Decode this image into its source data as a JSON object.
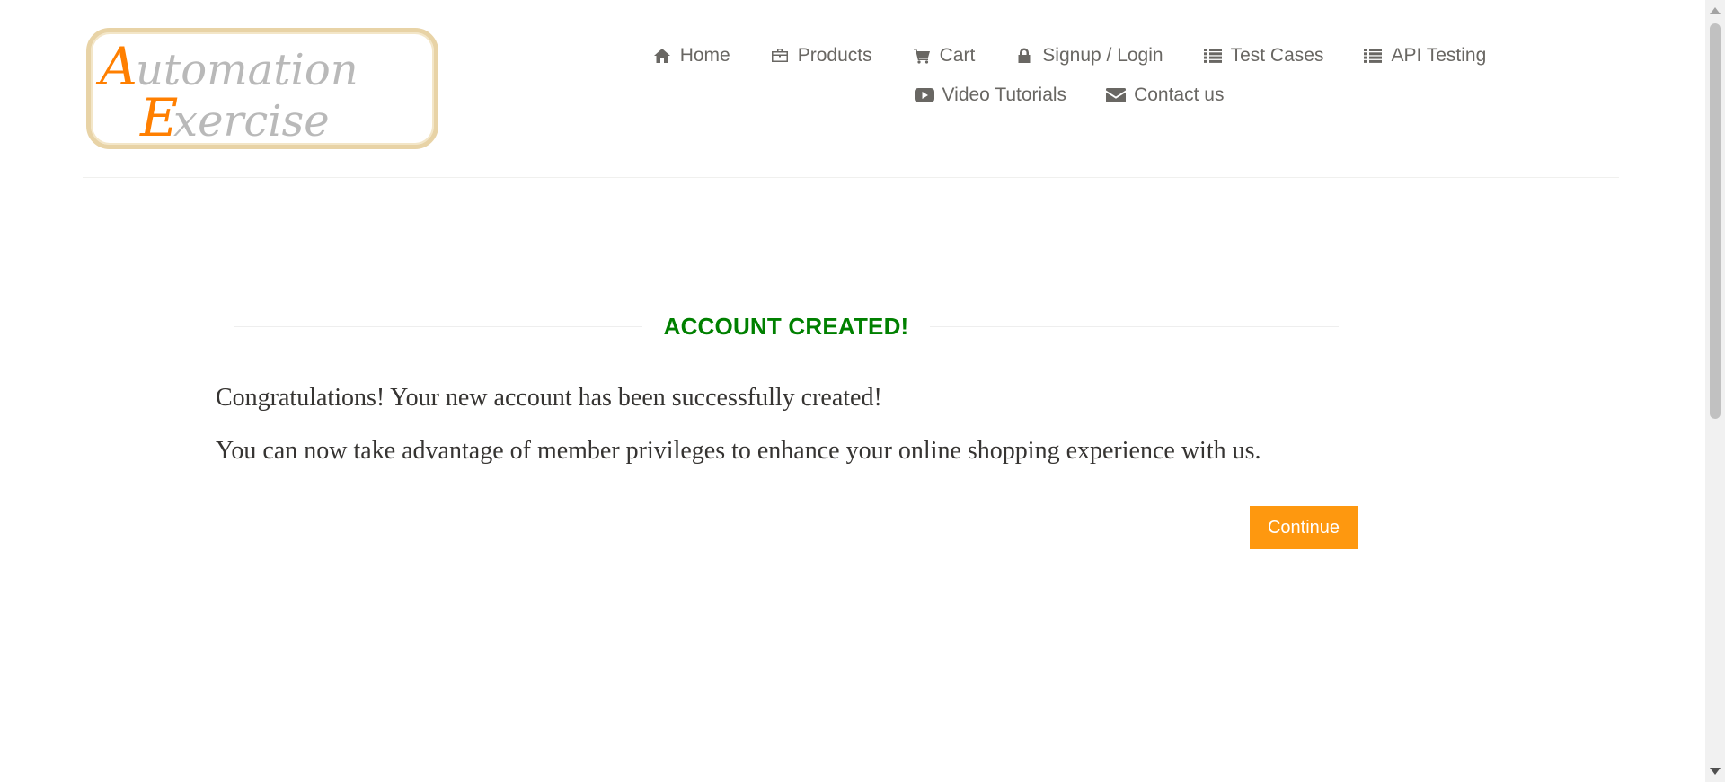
{
  "logo": {
    "line1_accent": "A",
    "line1_rest": "utomation",
    "line2_accent": "E",
    "line2_rest": "xercise"
  },
  "nav": {
    "row1": [
      {
        "label": "Home",
        "icon": "home-icon"
      },
      {
        "label": "Products",
        "icon": "briefcase-icon"
      },
      {
        "label": "Cart",
        "icon": "cart-icon"
      },
      {
        "label": "Signup / Login",
        "icon": "lock-icon"
      },
      {
        "label": "Test Cases",
        "icon": "list-icon"
      },
      {
        "label": "API Testing",
        "icon": "list-icon"
      }
    ],
    "row2": [
      {
        "label": "Video Tutorials",
        "icon": "youtube-play-icon"
      },
      {
        "label": "Contact us",
        "icon": "envelope-icon"
      }
    ]
  },
  "main": {
    "title": "ACCOUNT CREATED!",
    "message1": "Congratulations! Your new account has been successfully created!",
    "message2": "You can now take advantage of member privileges to enhance your online shopping experience with us.",
    "continue_label": "Continue"
  },
  "colors": {
    "accent": "#fe980f",
    "title_green": "#008000",
    "nav_text": "#696763",
    "logo_orange": "#ff7f00",
    "logo_gray": "#b9b9b9",
    "logo_border": "#e8d3a6"
  }
}
